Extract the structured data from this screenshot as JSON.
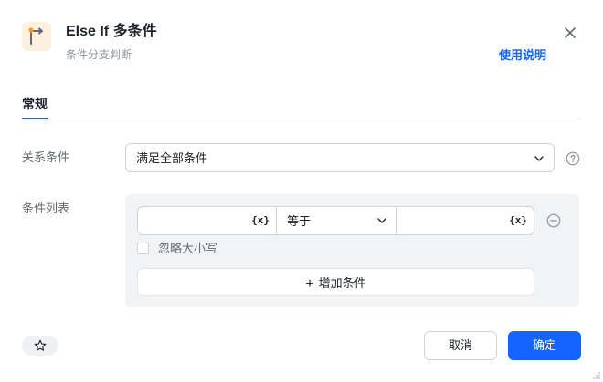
{
  "header": {
    "title": "Else If 多条件",
    "subtitle": "条件分支判断",
    "help_link": "使用说明",
    "icon": "branch-icon",
    "accent_color": "#f29d38"
  },
  "tabs": [
    {
      "label": "常规",
      "active": true
    }
  ],
  "form": {
    "relation_label": "关系条件",
    "relation_value": "满足全部条件",
    "list_label": "条件列表",
    "conditions": [
      {
        "left_value": "",
        "left_var_icon": "{x}",
        "operator": "等于",
        "right_value": "",
        "right_var_icon": "{x}"
      }
    ],
    "ignore_case_label": "忽略大小写",
    "ignore_case_checked": false,
    "add_condition_label": "增加条件"
  },
  "footer": {
    "cancel_label": "取消",
    "ok_label": "确定"
  },
  "colors": {
    "primary": "#1664ff",
    "panel_bg": "#f2f3f5",
    "border": "#d0d3d6"
  }
}
